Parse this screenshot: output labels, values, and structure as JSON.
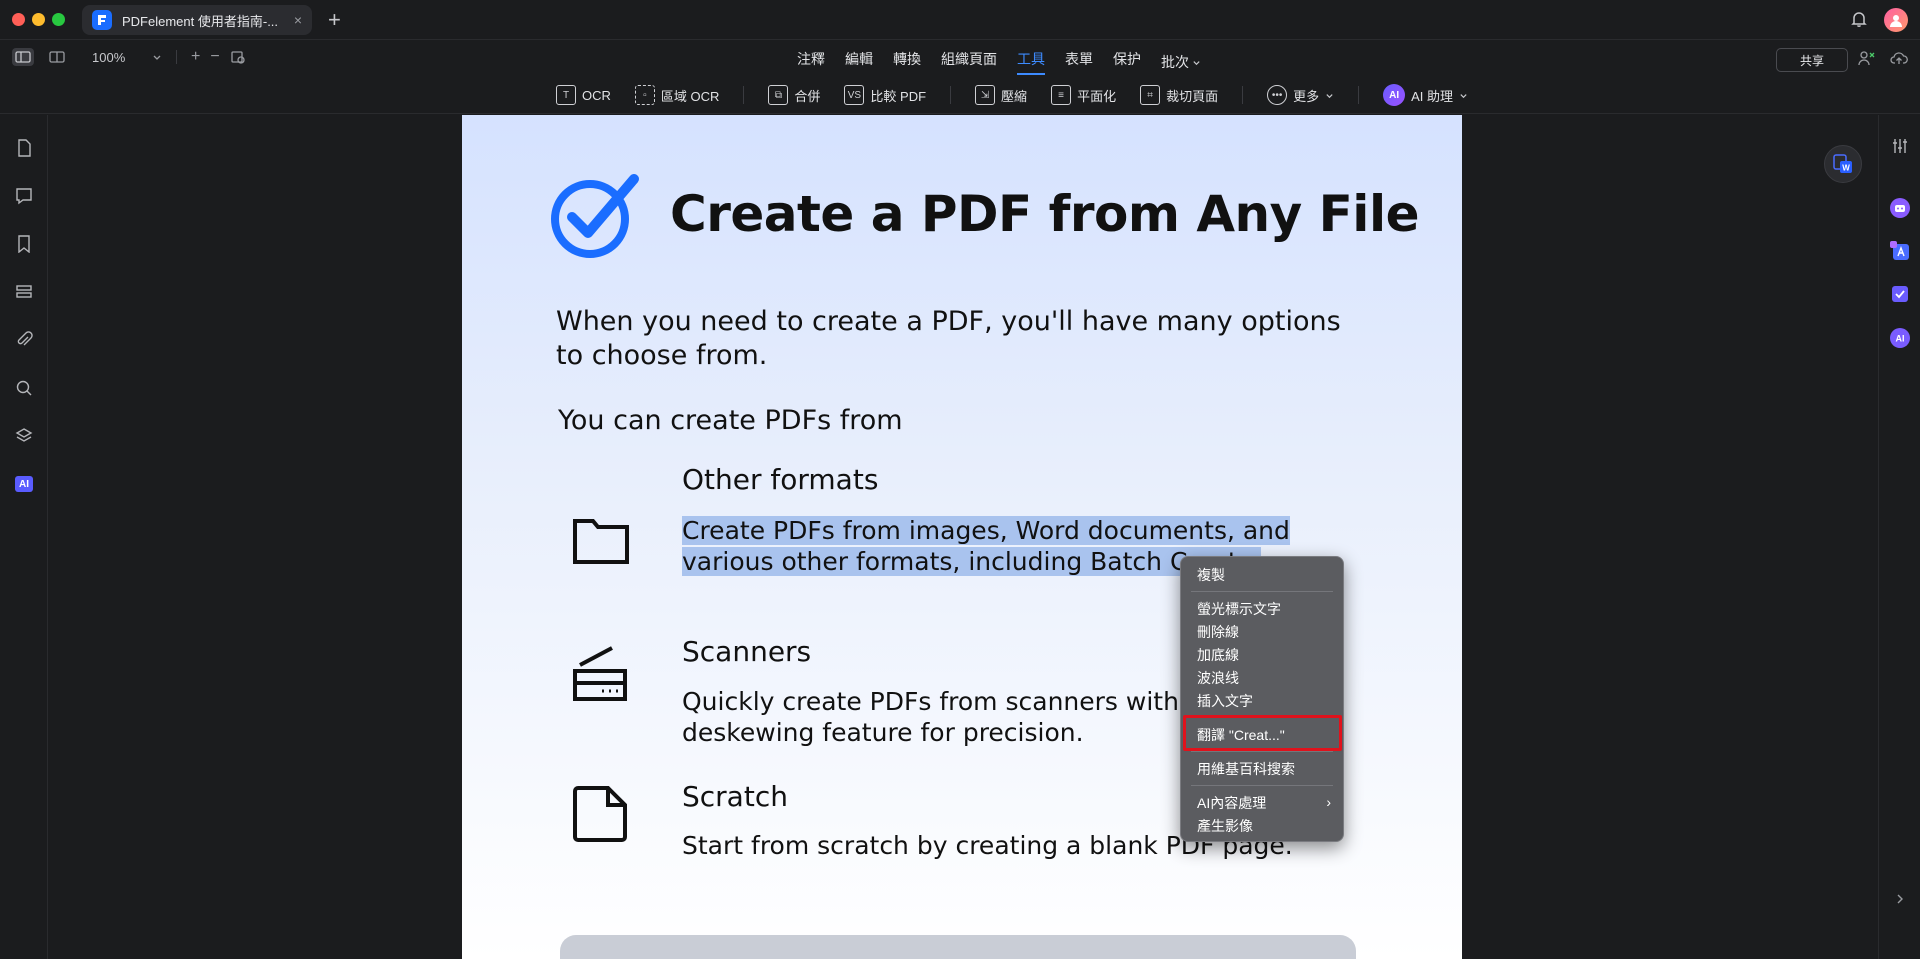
{
  "window": {
    "tab_title": "PDFelement 使用者指南-...",
    "tab_close": "×",
    "new_tab": "+"
  },
  "toolbar": {
    "zoom": "100%",
    "zoom_in": "+",
    "zoom_out": "−",
    "menu": [
      "注釋",
      "編輯",
      "轉換",
      "組織頁面",
      "工具",
      "表單",
      "保护",
      "批次"
    ],
    "active_menu": "工具",
    "share": "共享"
  },
  "tools": {
    "ocr": "OCR",
    "region_ocr": "區域 OCR",
    "merge": "合併",
    "compare": "比較 PDF",
    "compress": "壓縮",
    "flatten": "平面化",
    "crop": "裁切頁面",
    "more": "更多",
    "ai_assistant": "AI 助理",
    "ai_badge": "AI"
  },
  "document": {
    "title": "Create a PDF from Any File",
    "intro": "When you need to create a PDF, you'll have many options to choose from.",
    "sub": "You can create PDFs from",
    "sections": [
      {
        "heading": "Other formats",
        "text_line1": "Create PDFs from images, Word documents, and",
        "text_line2": "various other formats, including Batch Create."
      },
      {
        "heading": "Scanners",
        "text_line1": "Quickly create PDFs from scanners with the",
        "text_line2": "deskewing feature for precision."
      },
      {
        "heading": "Scratch",
        "text_line1": "Start from scratch by creating a blank PDF page.",
        "text_line2": ""
      }
    ]
  },
  "context_menu": {
    "copy": "複製",
    "highlight": "螢光標示文字",
    "strikethrough": "刪除線",
    "underline": "加底線",
    "squiggly": "波浪线",
    "insert_text": "插入文字",
    "translate": "翻譯 \"Creat...\"",
    "wiki": "用維基百科搜索",
    "ai_process": "AI內容處理",
    "generate_image": "產生影像",
    "submenu_arrow": "›"
  },
  "leftbar_ai": "AI",
  "colors": {
    "accent": "#3d8bff",
    "selection": "#a9c3ee",
    "highlight_box": "#e0121c",
    "menu_bg": "#5b5c60"
  }
}
